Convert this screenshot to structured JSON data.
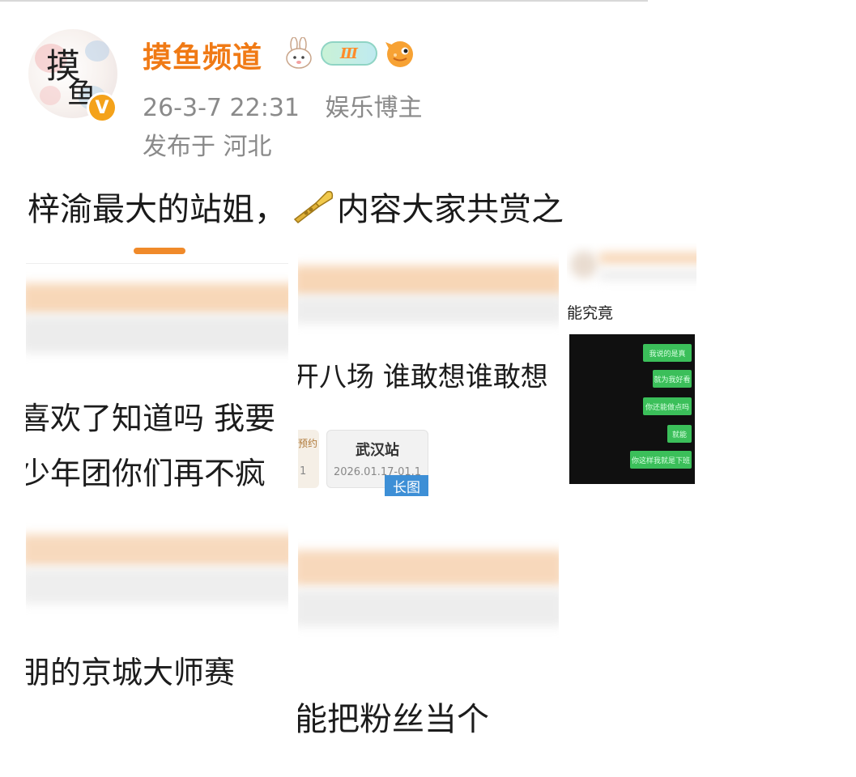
{
  "post": {
    "username": "摸鱼频道",
    "level_badge": "Ⅲ",
    "timestamp": "26-3-7 22:31",
    "account_type": "娱乐博主",
    "location": "发布于 河北",
    "text_before_emoji": "梓渝最大的站姐，",
    "text_after_emoji": "内容大家共赏之",
    "verify_mark": "V",
    "avatar_text_1": "摸",
    "avatar_text_2": "鱼"
  },
  "images": {
    "left": {
      "line1": "喜欢了知道吗 我要",
      "line2": "少年团你们再不疯",
      "line3": "朋的京城大师赛"
    },
    "middle": {
      "line1": "开八场 谁敢想谁敢想",
      "ticket_side_label": "预约",
      "ticket_side_num": "1",
      "ticket_title": "武汉站",
      "ticket_date": "2026.01.17-01.1",
      "long_image_badge": "长图",
      "line2": "能把粉丝当个"
    },
    "right": {
      "caption": "能究竟",
      "chat_messages": [
        "我说的是真",
        "就为我好看",
        "你还能做点吗",
        "就能",
        "你这样我就是下班"
      ]
    }
  },
  "colors": {
    "username": "#f07a15",
    "meta": "#8a8a8a",
    "verify": "#f4a21a",
    "chat_bubble": "#3bbf5a",
    "long_badge": "#3d8fd6"
  },
  "icons": [
    "verified-icon",
    "bunny-badge-icon",
    "level-badge-icon",
    "fish-badge-icon",
    "trumpet-emoji-icon"
  ]
}
